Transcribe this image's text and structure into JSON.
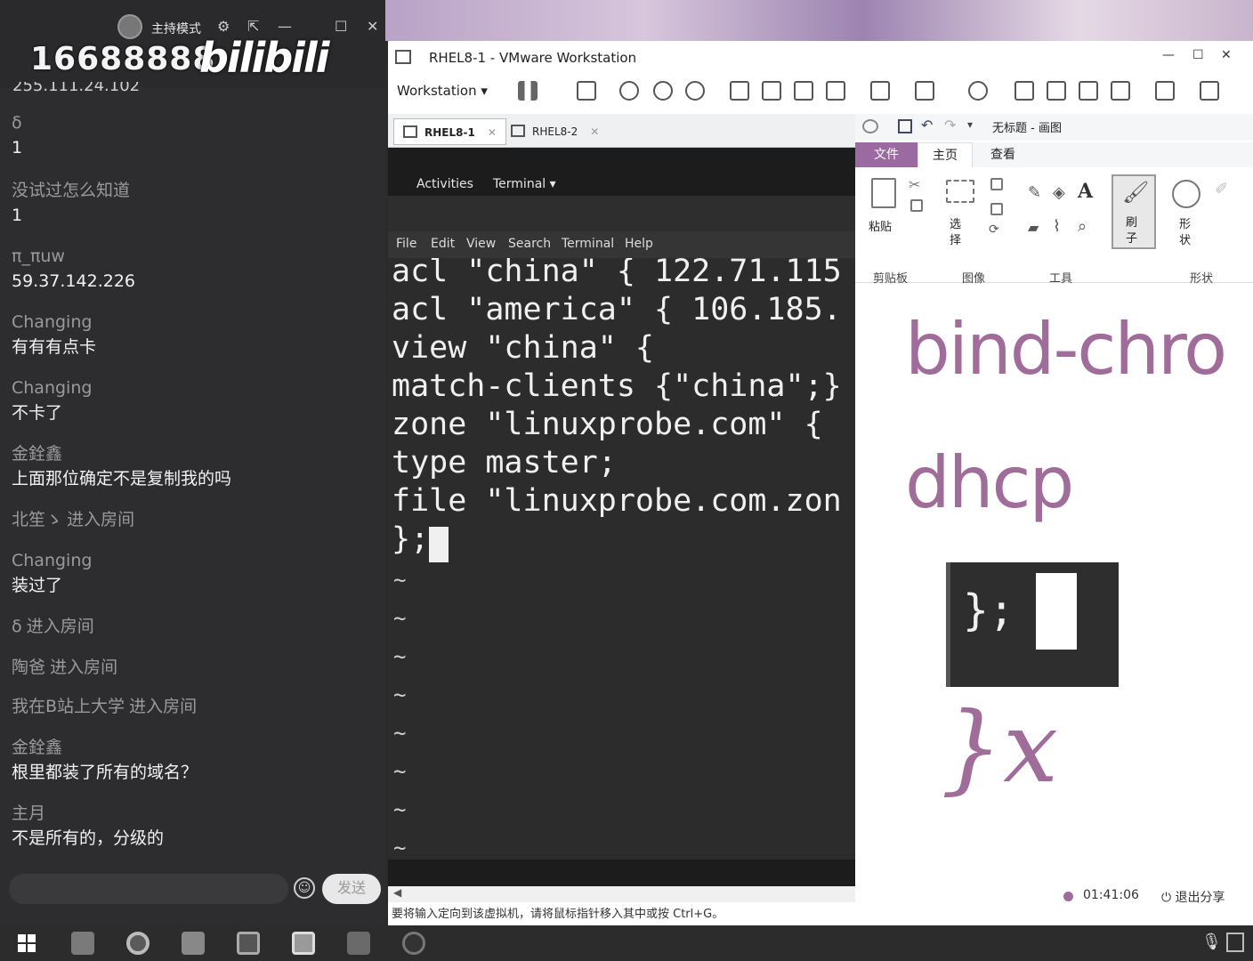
{
  "chat": {
    "host_mode": "主持模式",
    "room_id": "16688888",
    "logo": "bilibili",
    "ip_partial": "255.111.24.102",
    "messages": [
      {
        "user": "δ",
        "text": "1"
      },
      {
        "user": "没试过怎么知道",
        "text": "1"
      },
      {
        "user": "π_πuw",
        "text": "59.37.142.226"
      },
      {
        "user": "Changing",
        "text": "有有有点卡"
      },
      {
        "user": "Changing",
        "text": "不卡了"
      },
      {
        "user": "金銓鑫",
        "text": "上面那位确定不是复制我的吗"
      },
      {
        "user": "北笙ゝ",
        "text": "进入房间"
      },
      {
        "user": "Changing",
        "text": "装过了"
      },
      {
        "user": "δ",
        "text": "进入房间"
      },
      {
        "user": "陶爸",
        "text": "进入房间"
      },
      {
        "user": "我在B站上大学",
        "text": "进入房间"
      },
      {
        "user": "金銓鑫",
        "text": "根里都装了所有的域名？"
      },
      {
        "user": "主月",
        "text": "不是所有的，分级的"
      }
    ],
    "send_label": "发送"
  },
  "vmware": {
    "title": "RHEL8-1 - VMware Workstation",
    "menu": "Workstation",
    "tabs": [
      {
        "label": "RHEL8-1"
      },
      {
        "label": "RHEL8-2"
      }
    ],
    "status_text": "要将输入定向到该虚拟机，请将鼠标指针移入其中或按 Ctrl+G。"
  },
  "guest": {
    "activities": "Activities",
    "terminal_menu": "Terminal ▾",
    "menubar": [
      "File",
      "Edit",
      "View",
      "Search",
      "Terminal",
      "Help"
    ],
    "lines": [
      "acl \"china\" { 122.71.115",
      "acl \"america\" { 106.185.",
      "view \"china\" {",
      "match-clients {\"china\";}",
      "zone \"linuxprobe.com\" {",
      "type master;",
      "file \"linuxprobe.com.zon",
      "};"
    ],
    "tilde": "~"
  },
  "paint": {
    "title": "无标题 - 画图",
    "tabs": [
      "文件",
      "主页",
      "查看"
    ],
    "ribbon": {
      "paste": "粘贴",
      "select": "选择",
      "brush": "刷子",
      "shapes": "形状",
      "group_clipboard": "剪贴板",
      "group_image": "图像",
      "group_tools": "工具",
      "group_shapes": "形状"
    },
    "canvas": {
      "handwriting_1": "bind-chro",
      "handwriting_2": "dhcp",
      "snippet": "};",
      "handwriting_3": "}x"
    },
    "record_time": "01:41:06",
    "exit_share": "退出分享"
  },
  "colors": {
    "accent": "#9b6aa0",
    "terminal_bg": "#2c2c2c",
    "chat_bg": "#2d2d2f"
  }
}
